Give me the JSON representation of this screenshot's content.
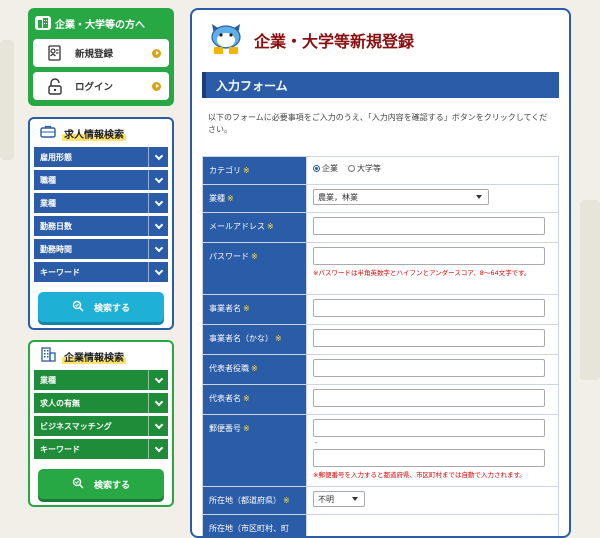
{
  "account_panel": {
    "heading": "企業・大学等の方へ",
    "register_label": "新規登録",
    "login_label": "ログイン"
  },
  "job_search": {
    "heading": "求人情報検索",
    "filters": [
      "雇用形態",
      "職種",
      "業種",
      "勤務日数",
      "勤務時間",
      "キーワード"
    ],
    "button_label": "検索する"
  },
  "company_search": {
    "heading": "企業情報検索",
    "filters": [
      "業種",
      "求人の有無",
      "ビジネスマッチング",
      "キーワード"
    ],
    "button_label": "検索する"
  },
  "main": {
    "title": "企業・大学等新規登録",
    "form_heading": "入力フォーム",
    "intro": "以下のフォームに必要事項をご入力のうえ、「入力内容を確認する」ボタンをクリックしてください。",
    "required_mark": "※",
    "fields": {
      "category": {
        "label": "カテゴリ",
        "options": [
          "企業",
          "大学等"
        ],
        "selected": "企業"
      },
      "industry": {
        "label": "業種",
        "value": "農業，林業"
      },
      "email": {
        "label": "メールアドレス",
        "value": ""
      },
      "password": {
        "label": "パスワード",
        "value": "",
        "note": "※パスワードは半角英数字とハイフンとアンダースコア、8〜64文字です。"
      },
      "company_name": {
        "label": "事業者名",
        "value": ""
      },
      "company_kana": {
        "label": "事業者名（かな）",
        "value": ""
      },
      "rep_title": {
        "label": "代表者役職",
        "value": ""
      },
      "rep_name": {
        "label": "代表者名",
        "value": ""
      },
      "postal": {
        "label": "郵便番号",
        "separator": "-",
        "note": "※郵便番号を入力すると都道府県、市区町村までは自動で入力されます。"
      },
      "prefecture": {
        "label": "所在地（都道府県）",
        "value": "不明"
      },
      "city": {
        "label": "所在地（市区町村、町"
      }
    }
  },
  "colors": {
    "blue": "#2a5ca8",
    "green": "#27a845",
    "title_red": "#8a1010",
    "cyan_button": "#1fb0d6"
  },
  "icons": [
    "company-icon",
    "register-icon",
    "lock-icon",
    "briefcase-icon",
    "building-icon",
    "search-check-icon",
    "mascot-icon"
  ]
}
